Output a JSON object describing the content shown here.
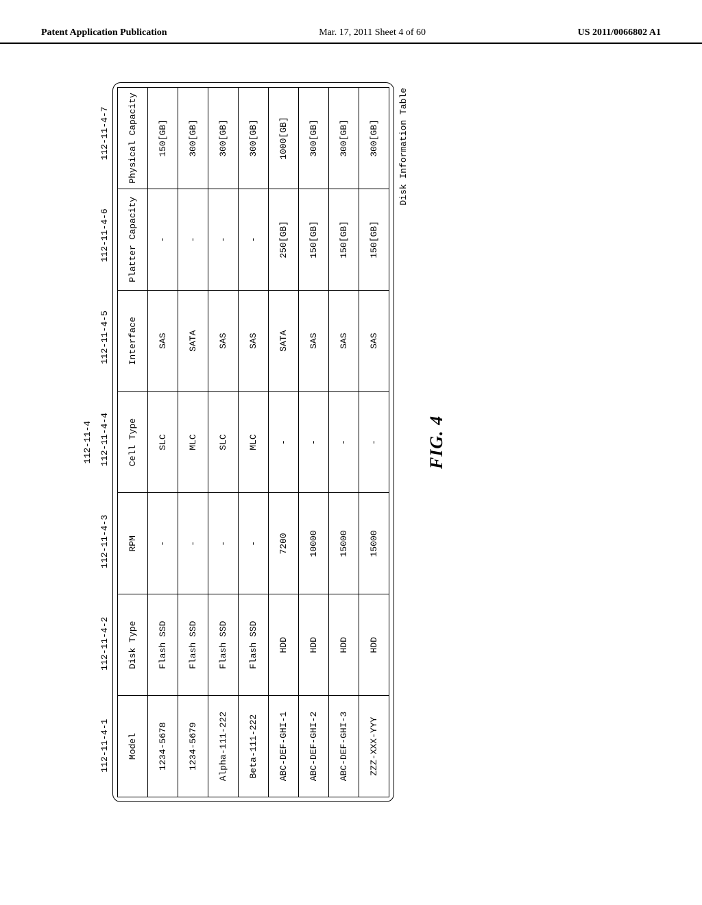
{
  "header": {
    "left": "Patent Application Publication",
    "mid": "Mar. 17, 2011  Sheet 4 of 60",
    "right": "US 2011/0066802 A1"
  },
  "refs": {
    "top": "112-11-4",
    "c1": "112-11-4-1",
    "c2": "112-11-4-2",
    "c3": "112-11-4-3",
    "c4": "112-11-4-4",
    "c5": "112-11-4-5",
    "c6": "112-11-4-6",
    "c7": "112-11-4-7"
  },
  "columns": {
    "c1": "Model",
    "c2": "Disk Type",
    "c3": "RPM",
    "c4": "Cell Type",
    "c5": "Interface",
    "c6": "Platter Capacity",
    "c7": "Physical Capacity"
  },
  "chart_data": {
    "type": "table",
    "columns": [
      "Model",
      "Disk Type",
      "RPM",
      "Cell Type",
      "Interface",
      "Platter Capacity",
      "Physical Capacity"
    ],
    "rows": [
      {
        "model": "1234-5678",
        "disk_type": "Flash SSD",
        "rpm": "-",
        "cell_type": "SLC",
        "interface": "SAS",
        "platter": "-",
        "physical": "150[GB]"
      },
      {
        "model": "1234-5679",
        "disk_type": "Flash SSD",
        "rpm": "-",
        "cell_type": "MLC",
        "interface": "SATA",
        "platter": "-",
        "physical": "300[GB]"
      },
      {
        "model": "Alpha-111-222",
        "disk_type": "Flash SSD",
        "rpm": "-",
        "cell_type": "SLC",
        "interface": "SAS",
        "platter": "-",
        "physical": "300[GB]"
      },
      {
        "model": "Beta-111-222",
        "disk_type": "Flash SSD",
        "rpm": "-",
        "cell_type": "MLC",
        "interface": "SAS",
        "platter": "-",
        "physical": "300[GB]"
      },
      {
        "model": "ABC-DEF-GHI-1",
        "disk_type": "HDD",
        "rpm": "7200",
        "cell_type": "-",
        "interface": "SATA",
        "platter": "250[GB]",
        "physical": "1000[GB]"
      },
      {
        "model": "ABC-DEF-GHI-2",
        "disk_type": "HDD",
        "rpm": "10000",
        "cell_type": "-",
        "interface": "SAS",
        "platter": "150[GB]",
        "physical": "300[GB]"
      },
      {
        "model": "ABC-DEF-GHI-3",
        "disk_type": "HDD",
        "rpm": "15000",
        "cell_type": "-",
        "interface": "SAS",
        "platter": "150[GB]",
        "physical": "300[GB]"
      },
      {
        "model": "ZZZ-XXX-YYY",
        "disk_type": "HDD",
        "rpm": "15000",
        "cell_type": "-",
        "interface": "SAS",
        "platter": "150[GB]",
        "physical": "300[GB]"
      }
    ]
  },
  "caption": "Disk Information Table",
  "figure_label": "FIG. 4"
}
